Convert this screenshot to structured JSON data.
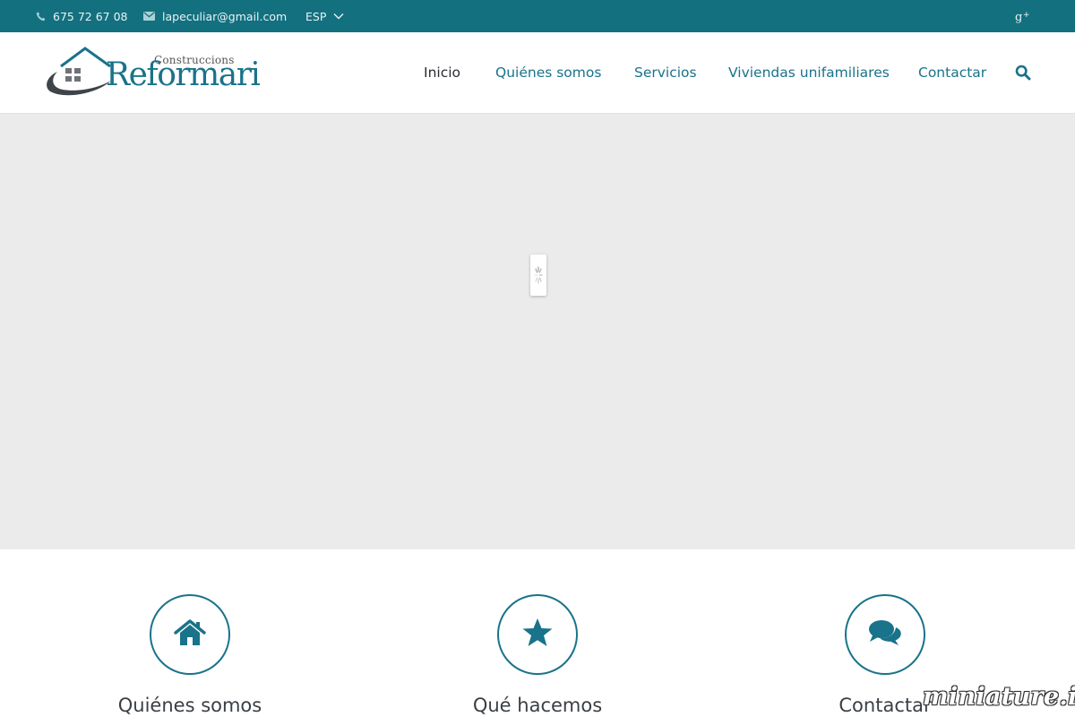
{
  "topbar": {
    "phone": "675 72 67 08",
    "email": "lapeculiar@gmail.com",
    "language": "ESP",
    "icons": [
      "phone-icon",
      "envelope-icon",
      "chevron-down-icon",
      "google-plus-icon"
    ],
    "background": "#13707f"
  },
  "header": {
    "logo_small": "Construccions",
    "logo_big": "Reformari",
    "nav": [
      {
        "label": "Inicio",
        "active": true
      },
      {
        "label": "Quiénes somos",
        "active": false
      },
      {
        "label": "Servicios",
        "active": false
      },
      {
        "label": "Viviendas unifamiliares",
        "active": false
      },
      {
        "label": "Contactar",
        "active": false
      }
    ],
    "search_icon": "search-icon",
    "accent": "#19738a"
  },
  "slider": {
    "state": "loading",
    "background": "#ebebeb"
  },
  "features": [
    {
      "icon": "home-icon",
      "title": "Quiénes somos"
    },
    {
      "icon": "star-icon",
      "title": "Qué hacemos"
    },
    {
      "icon": "comments-icon",
      "title": "Contactar"
    }
  ],
  "watermark": "miniature.io"
}
